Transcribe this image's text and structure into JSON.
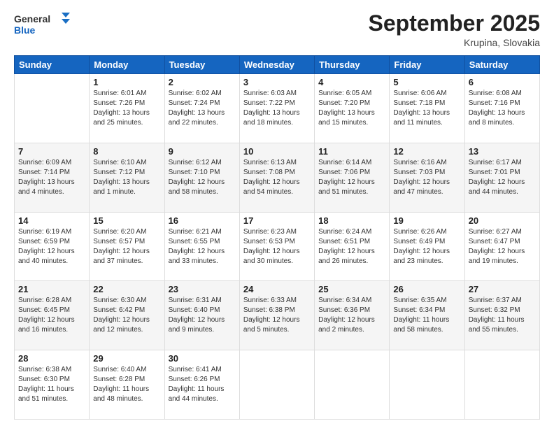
{
  "header": {
    "logo_general": "General",
    "logo_blue": "Blue",
    "month_title": "September 2025",
    "location": "Krupina, Slovakia"
  },
  "days_of_week": [
    "Sunday",
    "Monday",
    "Tuesday",
    "Wednesday",
    "Thursday",
    "Friday",
    "Saturday"
  ],
  "weeks": [
    [
      {
        "day": "",
        "info": ""
      },
      {
        "day": "1",
        "info": "Sunrise: 6:01 AM\nSunset: 7:26 PM\nDaylight: 13 hours\nand 25 minutes."
      },
      {
        "day": "2",
        "info": "Sunrise: 6:02 AM\nSunset: 7:24 PM\nDaylight: 13 hours\nand 22 minutes."
      },
      {
        "day": "3",
        "info": "Sunrise: 6:03 AM\nSunset: 7:22 PM\nDaylight: 13 hours\nand 18 minutes."
      },
      {
        "day": "4",
        "info": "Sunrise: 6:05 AM\nSunset: 7:20 PM\nDaylight: 13 hours\nand 15 minutes."
      },
      {
        "day": "5",
        "info": "Sunrise: 6:06 AM\nSunset: 7:18 PM\nDaylight: 13 hours\nand 11 minutes."
      },
      {
        "day": "6",
        "info": "Sunrise: 6:08 AM\nSunset: 7:16 PM\nDaylight: 13 hours\nand 8 minutes."
      }
    ],
    [
      {
        "day": "7",
        "info": "Sunrise: 6:09 AM\nSunset: 7:14 PM\nDaylight: 13 hours\nand 4 minutes."
      },
      {
        "day": "8",
        "info": "Sunrise: 6:10 AM\nSunset: 7:12 PM\nDaylight: 13 hours\nand 1 minute."
      },
      {
        "day": "9",
        "info": "Sunrise: 6:12 AM\nSunset: 7:10 PM\nDaylight: 12 hours\nand 58 minutes."
      },
      {
        "day": "10",
        "info": "Sunrise: 6:13 AM\nSunset: 7:08 PM\nDaylight: 12 hours\nand 54 minutes."
      },
      {
        "day": "11",
        "info": "Sunrise: 6:14 AM\nSunset: 7:06 PM\nDaylight: 12 hours\nand 51 minutes."
      },
      {
        "day": "12",
        "info": "Sunrise: 6:16 AM\nSunset: 7:03 PM\nDaylight: 12 hours\nand 47 minutes."
      },
      {
        "day": "13",
        "info": "Sunrise: 6:17 AM\nSunset: 7:01 PM\nDaylight: 12 hours\nand 44 minutes."
      }
    ],
    [
      {
        "day": "14",
        "info": "Sunrise: 6:19 AM\nSunset: 6:59 PM\nDaylight: 12 hours\nand 40 minutes."
      },
      {
        "day": "15",
        "info": "Sunrise: 6:20 AM\nSunset: 6:57 PM\nDaylight: 12 hours\nand 37 minutes."
      },
      {
        "day": "16",
        "info": "Sunrise: 6:21 AM\nSunset: 6:55 PM\nDaylight: 12 hours\nand 33 minutes."
      },
      {
        "day": "17",
        "info": "Sunrise: 6:23 AM\nSunset: 6:53 PM\nDaylight: 12 hours\nand 30 minutes."
      },
      {
        "day": "18",
        "info": "Sunrise: 6:24 AM\nSunset: 6:51 PM\nDaylight: 12 hours\nand 26 minutes."
      },
      {
        "day": "19",
        "info": "Sunrise: 6:26 AM\nSunset: 6:49 PM\nDaylight: 12 hours\nand 23 minutes."
      },
      {
        "day": "20",
        "info": "Sunrise: 6:27 AM\nSunset: 6:47 PM\nDaylight: 12 hours\nand 19 minutes."
      }
    ],
    [
      {
        "day": "21",
        "info": "Sunrise: 6:28 AM\nSunset: 6:45 PM\nDaylight: 12 hours\nand 16 minutes."
      },
      {
        "day": "22",
        "info": "Sunrise: 6:30 AM\nSunset: 6:42 PM\nDaylight: 12 hours\nand 12 minutes."
      },
      {
        "day": "23",
        "info": "Sunrise: 6:31 AM\nSunset: 6:40 PM\nDaylight: 12 hours\nand 9 minutes."
      },
      {
        "day": "24",
        "info": "Sunrise: 6:33 AM\nSunset: 6:38 PM\nDaylight: 12 hours\nand 5 minutes."
      },
      {
        "day": "25",
        "info": "Sunrise: 6:34 AM\nSunset: 6:36 PM\nDaylight: 12 hours\nand 2 minutes."
      },
      {
        "day": "26",
        "info": "Sunrise: 6:35 AM\nSunset: 6:34 PM\nDaylight: 11 hours\nand 58 minutes."
      },
      {
        "day": "27",
        "info": "Sunrise: 6:37 AM\nSunset: 6:32 PM\nDaylight: 11 hours\nand 55 minutes."
      }
    ],
    [
      {
        "day": "28",
        "info": "Sunrise: 6:38 AM\nSunset: 6:30 PM\nDaylight: 11 hours\nand 51 minutes."
      },
      {
        "day": "29",
        "info": "Sunrise: 6:40 AM\nSunset: 6:28 PM\nDaylight: 11 hours\nand 48 minutes."
      },
      {
        "day": "30",
        "info": "Sunrise: 6:41 AM\nSunset: 6:26 PM\nDaylight: 11 hours\nand 44 minutes."
      },
      {
        "day": "",
        "info": ""
      },
      {
        "day": "",
        "info": ""
      },
      {
        "day": "",
        "info": ""
      },
      {
        "day": "",
        "info": ""
      }
    ]
  ]
}
